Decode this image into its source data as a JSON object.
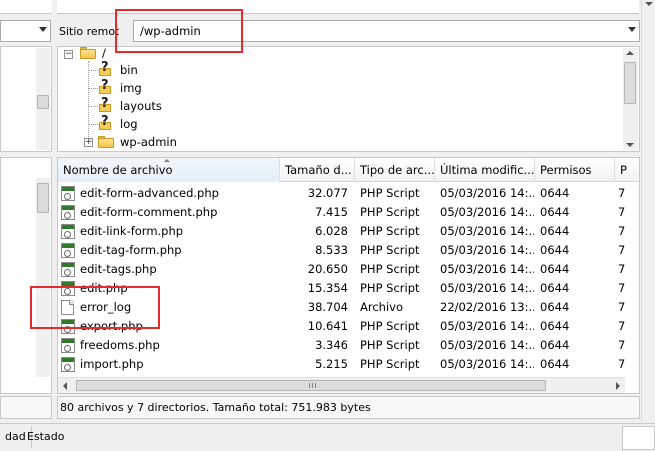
{
  "remote": {
    "site_label": "Sitio remoto:",
    "path_value": "/wp-admin"
  },
  "tree": {
    "items": [
      {
        "label": "/",
        "icon": "folder-icon"
      },
      {
        "label": "bin",
        "icon": "question-folder-icon"
      },
      {
        "label": "img",
        "icon": "question-folder-icon"
      },
      {
        "label": "layouts",
        "icon": "question-folder-icon"
      },
      {
        "label": "log",
        "icon": "question-folder-icon"
      },
      {
        "label": "wp-admin",
        "icon": "folder-icon"
      }
    ]
  },
  "file_list": {
    "columns": [
      {
        "label": "Nombre de archivo"
      },
      {
        "label": "Tamaño d..."
      },
      {
        "label": "Tipo de arc..."
      },
      {
        "label": "Última modific..."
      },
      {
        "label": "Permisos"
      },
      {
        "label": "P"
      }
    ],
    "rows": [
      {
        "name": "edit-form-advanced.php",
        "size": "32.077",
        "type": "PHP Script",
        "modified": "05/03/2016 14:...",
        "perms": "0644",
        "owner": "7",
        "icon": "php-file-icon"
      },
      {
        "name": "edit-form-comment.php",
        "size": "7.415",
        "type": "PHP Script",
        "modified": "05/03/2016 14:...",
        "perms": "0644",
        "owner": "7",
        "icon": "php-file-icon"
      },
      {
        "name": "edit-link-form.php",
        "size": "6.028",
        "type": "PHP Script",
        "modified": "05/03/2016 14:...",
        "perms": "0644",
        "owner": "7",
        "icon": "php-file-icon"
      },
      {
        "name": "edit-tag-form.php",
        "size": "8.533",
        "type": "PHP Script",
        "modified": "05/03/2016 14:...",
        "perms": "0644",
        "owner": "7",
        "icon": "php-file-icon"
      },
      {
        "name": "edit-tags.php",
        "size": "20.650",
        "type": "PHP Script",
        "modified": "05/03/2016 14:...",
        "perms": "0644",
        "owner": "7",
        "icon": "php-file-icon"
      },
      {
        "name": "edit.php",
        "size": "15.354",
        "type": "PHP Script",
        "modified": "05/03/2016 14:...",
        "perms": "0644",
        "owner": "7",
        "icon": "php-file-icon"
      },
      {
        "name": "error_log",
        "size": "38.704",
        "type": "Archivo",
        "modified": "22/02/2016 13:...",
        "perms": "0644",
        "owner": "7",
        "icon": "file-icon"
      },
      {
        "name": "export.php",
        "size": "10.641",
        "type": "PHP Script",
        "modified": "05/03/2016 14:...",
        "perms": "0644",
        "owner": "7",
        "icon": "php-file-icon"
      },
      {
        "name": "freedoms.php",
        "size": "3.346",
        "type": "PHP Script",
        "modified": "05/03/2016 14:...",
        "perms": "0644",
        "owner": "7",
        "icon": "php-file-icon"
      },
      {
        "name": "import.php",
        "size": "5.215",
        "type": "PHP Script",
        "modified": "05/03/2016 14:...",
        "perms": "0644",
        "owner": "7",
        "icon": "php-file-icon"
      }
    ]
  },
  "status": {
    "remote_summary": "80 archivos y 7 directorios. Tamaño total: 751.983 bytes"
  },
  "queue_tabs": {
    "tab_a": "dad",
    "tab_b": "Estado"
  },
  "colors": {
    "highlight": "#e52b2b",
    "php_icon_bar": "#2d7a2d",
    "folder": "#f1c64f"
  }
}
